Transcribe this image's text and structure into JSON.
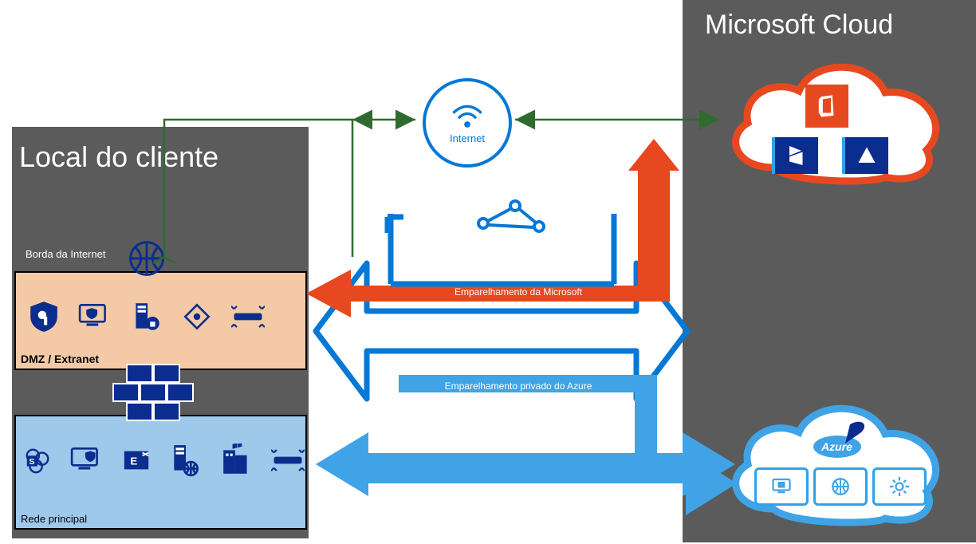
{
  "left_panel": {
    "title": "Local do cliente",
    "internet_border_label": "Borda da Internet",
    "dmz_label": "DMZ / Extranet",
    "core_label": "Rede principal"
  },
  "right_panel": {
    "title": "Microsoft Cloud"
  },
  "center": {
    "internet_label": "Internet",
    "microsoft_peering_label": "Emparelhamento da Microsoft",
    "azure_private_peering_label": "Emparelhamento privado do Azure"
  },
  "cloud_top": {
    "tiles": [
      "office",
      "dynamics",
      "azure-triangle"
    ]
  },
  "cloud_bottom": {
    "brand": "Azure",
    "tiles": [
      "monitor-cube",
      "grid-globe",
      "gear"
    ]
  },
  "colors": {
    "panel_gray": "#5b5b5b",
    "navy": "#0b2d8e",
    "azure_blue": "#2fa3e6",
    "bright_blue": "#0478d6",
    "orange": "#e8481f",
    "green_line": "#2f6b2f",
    "dmz_fill": "#f4caa6",
    "core_fill": "#9fc9eb"
  }
}
